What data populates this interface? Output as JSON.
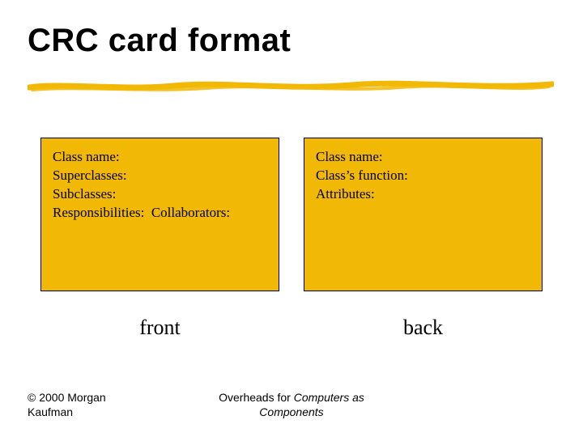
{
  "title": "CRC card format",
  "front_card": {
    "line1": "Class name:",
    "line2": "Superclasses:",
    "line3": "Subclasses:",
    "line4": "Responsibilities:  Collaborators:"
  },
  "back_card": {
    "line1": "Class name:",
    "line2": "Class’s function:",
    "line3": "Attributes:"
  },
  "labels": {
    "front": "front",
    "back": "back"
  },
  "footer": {
    "copyright_line1": "© 2000 Morgan",
    "copyright_line2": "Kaufman",
    "center_line1_a": "Overheads for ",
    "center_line1_b": "Computers as",
    "center_line2": "Components"
  },
  "colors": {
    "card_bg": "#f2b806",
    "stroke_yellow": "#f2b806"
  }
}
